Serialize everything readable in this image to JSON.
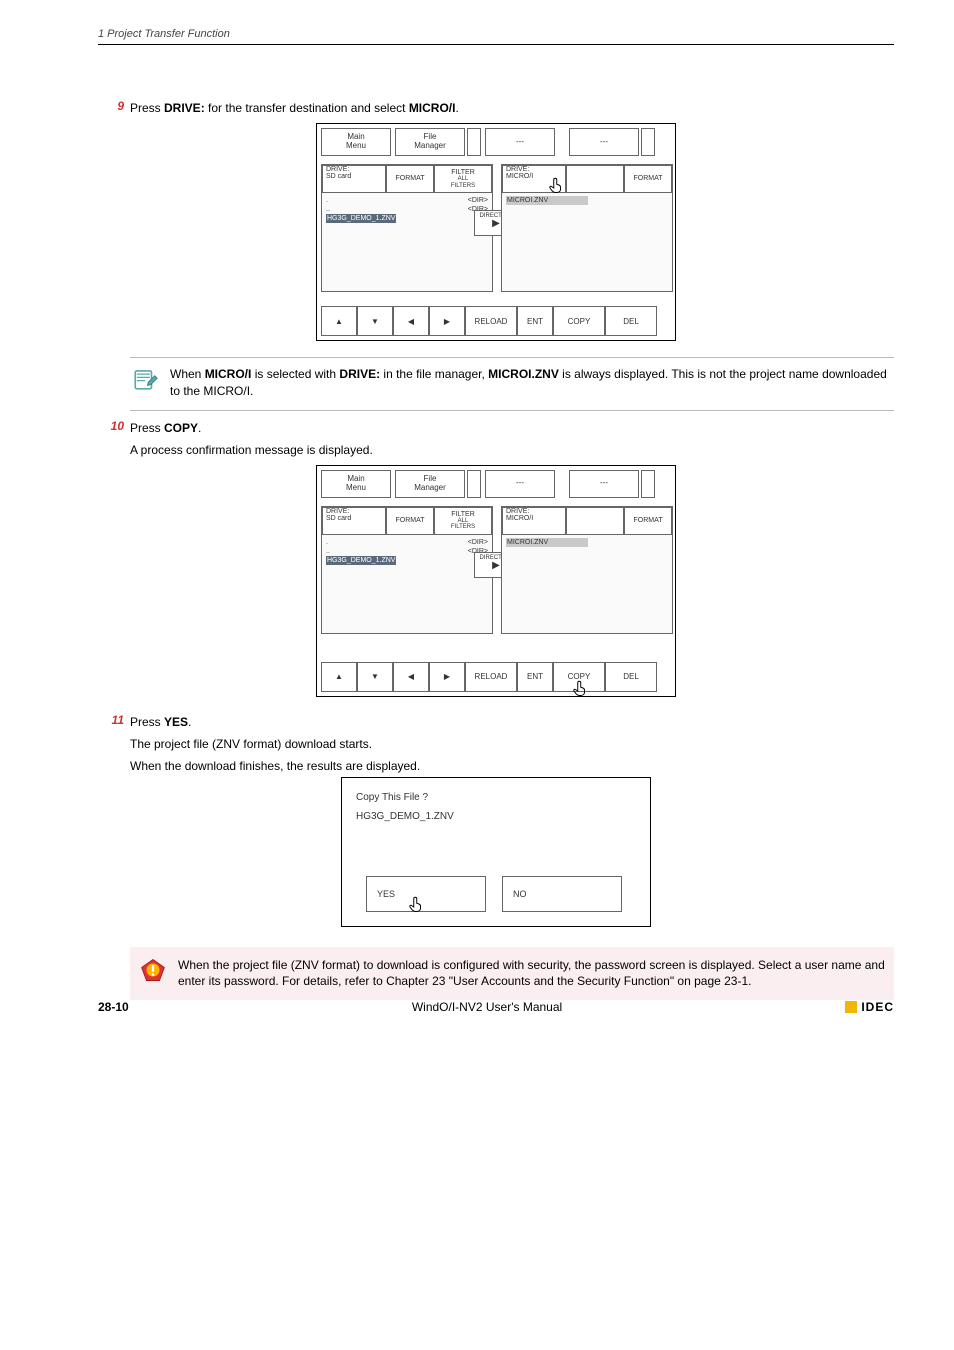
{
  "header": {
    "text": "1 Project Transfer Function"
  },
  "step9": {
    "num": "9",
    "text_parts": [
      "Press ",
      "DRIVE:",
      " for the transfer destination and select ",
      "MICRO/I",
      "."
    ]
  },
  "fm": {
    "top": {
      "main": "Main\nMenu",
      "file": "File\nManager",
      "dash1": "---",
      "dash2": "---"
    },
    "left": {
      "drive_lbl": "DRIVE:",
      "drive_val": "SD  card",
      "format": "FORMAT",
      "filter": "FILTER",
      "filter_sub": "ALL\nFILTERS",
      "list": {
        "dot": ".",
        "dotdot": "..",
        "dir": "<DIR>",
        "file": "HG3G_DEMO_1.ZNV"
      }
    },
    "right": {
      "drive_lbl": "DRIVE:",
      "drive_val": "MICRO/I",
      "format": "FORMAT",
      "file": "MICROI.ZNV"
    },
    "direction": "DIRECTION",
    "bottom": {
      "up": "▲",
      "down": "▼",
      "left": "◀",
      "right": "▶",
      "reload": "RELOAD",
      "ent": "ENT",
      "copy": "COPY",
      "del": "DEL"
    }
  },
  "note1": {
    "text_parts": [
      "When ",
      "MICRO/I",
      " is selected with ",
      "DRIVE:",
      " in the file manager, ",
      "MICROI.ZNV",
      " is always displayed. This is not the project name downloaded to the MICRO/I."
    ]
  },
  "step10": {
    "num": "10",
    "line1_parts": [
      "Press ",
      "COPY",
      "."
    ],
    "line2": "A process confirmation message is displayed."
  },
  "step11": {
    "num": "11",
    "line1_parts": [
      "Press ",
      "YES",
      "."
    ],
    "line2": "The project file (ZNV format) download starts.",
    "line3": "When the download finishes, the results are displayed."
  },
  "confirm": {
    "title": "Copy This File ?",
    "file": "HG3G_DEMO_1.ZNV",
    "yes": "YES",
    "no": "NO"
  },
  "note2": {
    "text": "When the project file (ZNV format) to download is configured with security, the password screen is displayed. Select a user name and enter its password. For details, refer to Chapter 23 \"User Accounts and the Security Function\" on page 23-1."
  },
  "footer": {
    "page": "28-10",
    "manual": "WindO/I-NV2 User's Manual",
    "brand": "IDEC"
  }
}
